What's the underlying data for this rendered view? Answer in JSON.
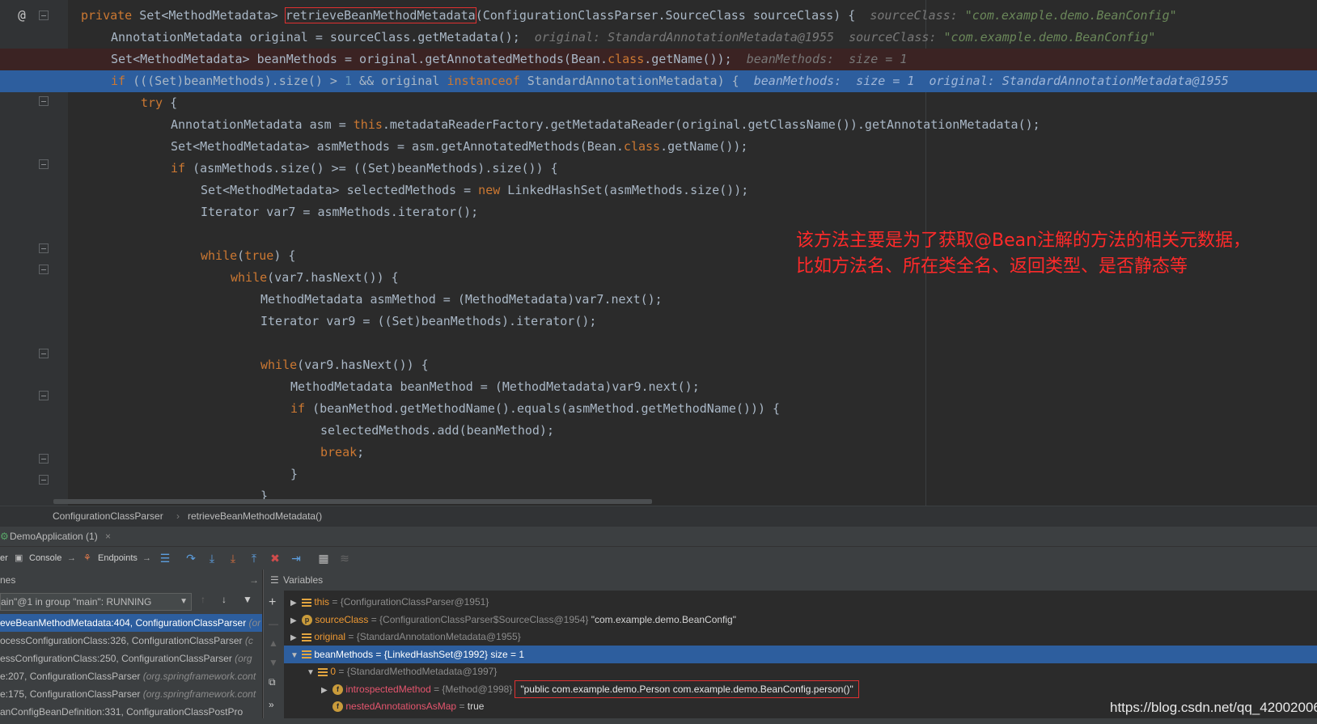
{
  "editor": {
    "lines": [
      {
        "indent": 0,
        "parts": [
          [
            "kw",
            "private "
          ],
          [
            "t",
            "Set<MethodMetadata> "
          ],
          [
            "box",
            "retrieveBeanMethodMetadata"
          ],
          [
            "t",
            "(ConfigurationClassParser.SourceClass sourceClass) {  "
          ],
          [
            "hint",
            "sourceClass: "
          ],
          [
            "hs",
            "\"com.example.demo.BeanConfig\""
          ]
        ]
      },
      {
        "indent": 1,
        "parts": [
          [
            "t",
            "AnnotationMetadata original = sourceClass.getMetadata();  "
          ],
          [
            "hint",
            "original: StandardAnnotationMetadata@1955  sourceClass: "
          ],
          [
            "hs",
            "\"com.example.demo.BeanConfig\""
          ]
        ]
      },
      {
        "indent": 1,
        "parts": [
          [
            "t",
            "Set<MethodMetadata> beanMethods = original.getAnnotatedMethods(Bean."
          ],
          [
            "kw",
            "class"
          ],
          [
            "t",
            ".getName());  "
          ],
          [
            "hint",
            "beanMethods:  size = 1"
          ]
        ]
      },
      {
        "indent": 1,
        "parts": [
          [
            "kw",
            "if "
          ],
          [
            "t",
            "(((Set)beanMethods).size() > "
          ],
          [
            "num",
            "1"
          ],
          [
            "t",
            " && original "
          ],
          [
            "kw",
            "instanceof "
          ],
          [
            "t",
            "StandardAnnotationMetadata) {  "
          ],
          [
            "hint",
            "beanMethods:  size = 1  original: StandardAnnotationMetadata@1955"
          ]
        ]
      },
      {
        "indent": 2,
        "parts": [
          [
            "kw",
            "try "
          ],
          [
            "t",
            "{"
          ]
        ]
      },
      {
        "indent": 3,
        "parts": [
          [
            "t",
            "AnnotationMetadata asm = "
          ],
          [
            "kw",
            "this"
          ],
          [
            "t",
            ".metadataReaderFactory.getMetadataReader(original.getClassName()).getAnnotationMetadata();"
          ]
        ]
      },
      {
        "indent": 3,
        "parts": [
          [
            "t",
            "Set<MethodMetadata> asmMethods = asm.getAnnotatedMethods(Bean."
          ],
          [
            "kw",
            "class"
          ],
          [
            "t",
            ".getName());"
          ]
        ]
      },
      {
        "indent": 3,
        "parts": [
          [
            "kw",
            "if "
          ],
          [
            "t",
            "(asmMethods.size() >= ((Set)beanMethods).size()) {"
          ]
        ]
      },
      {
        "indent": 4,
        "parts": [
          [
            "t",
            "Set<MethodMetadata> selectedMethods = "
          ],
          [
            "kw",
            "new "
          ],
          [
            "t",
            "LinkedHashSet(asmMethods.size());"
          ]
        ]
      },
      {
        "indent": 4,
        "parts": [
          [
            "t",
            "Iterator var7 = asmMethods.iterator();"
          ]
        ]
      },
      {
        "indent": 0,
        "parts": []
      },
      {
        "indent": 4,
        "parts": [
          [
            "kw",
            "while"
          ],
          [
            "t",
            "("
          ],
          [
            "kw",
            "true"
          ],
          [
            "t",
            ") {"
          ]
        ]
      },
      {
        "indent": 5,
        "parts": [
          [
            "kw",
            "while"
          ],
          [
            "t",
            "(var7.hasNext()) {"
          ]
        ]
      },
      {
        "indent": 6,
        "parts": [
          [
            "t",
            "MethodMetadata asmMethod = (MethodMetadata)var7.next();"
          ]
        ]
      },
      {
        "indent": 6,
        "parts": [
          [
            "t",
            "Iterator var9 = ((Set)beanMethods).iterator();"
          ]
        ]
      },
      {
        "indent": 0,
        "parts": []
      },
      {
        "indent": 6,
        "parts": [
          [
            "kw",
            "while"
          ],
          [
            "t",
            "(var9.hasNext()) {"
          ]
        ]
      },
      {
        "indent": 7,
        "parts": [
          [
            "t",
            "MethodMetadata beanMethod = (MethodMetadata)var9.next();"
          ]
        ]
      },
      {
        "indent": 7,
        "parts": [
          [
            "kw",
            "if "
          ],
          [
            "t",
            "(beanMethod.getMethodName().equals(asmMethod.getMethodName())) {"
          ]
        ]
      },
      {
        "indent": 8,
        "parts": [
          [
            "t",
            "selectedMethods.add(beanMethod);"
          ]
        ]
      },
      {
        "indent": 8,
        "parts": [
          [
            "kw",
            "break"
          ],
          [
            "t",
            ";"
          ]
        ]
      },
      {
        "indent": 7,
        "parts": [
          [
            "t",
            "}"
          ]
        ]
      },
      {
        "indent": 6,
        "parts": [
          [
            "t",
            "}"
          ]
        ]
      }
    ],
    "annotation": "该方法主要是为了获取@Bean注解的方法的相关元数据，\n比如方法名、所在类全名、返回类型、是否静态等"
  },
  "breadcrumb": {
    "items": [
      "ConfigurationClassParser",
      "retrieveBeanMethodMetadata()"
    ]
  },
  "runbar": {
    "config": "DemoApplication (1)",
    "close": "×"
  },
  "toolbar": {
    "console": "Console",
    "endpoints": "Endpoints"
  },
  "frames": {
    "header": "nes",
    "thread": "ain\"@1 in group \"main\": RUNNING",
    "rows": [
      {
        "main": "eveBeanMethodMetadata:404, ConfigurationClassParser ",
        "pkg": "(or"
      },
      {
        "main": "ocessConfigurationClass:326, ConfigurationClassParser ",
        "pkg": "(c"
      },
      {
        "main": "essConfigurationClass:250, ConfigurationClassParser ",
        "pkg": "(org"
      },
      {
        "main": "e:207, ConfigurationClassParser ",
        "pkg": "(org.springframework.cont"
      },
      {
        "main": "e:175, ConfigurationClassParser ",
        "pkg": "(org.springframework.cont"
      },
      {
        "main": "anConfigBeanDefinition:331, ConfigurationClassPostPro",
        "pkg": ""
      }
    ]
  },
  "variables": {
    "header": "Variables",
    "rows": [
      {
        "name": "this",
        "type": " = {ConfigurationClassParser@1951}",
        "value": ""
      },
      {
        "name": "sourceClass",
        "type": " = {ConfigurationClassParser$SourceClass@1954}",
        "value": " \"com.example.demo.BeanConfig\""
      },
      {
        "name": "original",
        "type": " = {StandardAnnotationMetadata@1955}",
        "value": ""
      },
      {
        "name": "beanMethods",
        "type": " = {LinkedHashSet@1992}",
        "value": "  size = 1"
      },
      {
        "name": "0",
        "type": " = {StandardMethodMetadata@1997}",
        "value": ""
      },
      {
        "name": "introspectedMethod",
        "type": " = {Method@1998}",
        "value": "\"public com.example.demo.Person com.example.demo.BeanConfig.person()\""
      },
      {
        "name": "nestedAnnotationsAsMap",
        "type": " = ",
        "value": "true"
      }
    ]
  },
  "watermark": "https://blog.csdn.net/qq_42002006"
}
